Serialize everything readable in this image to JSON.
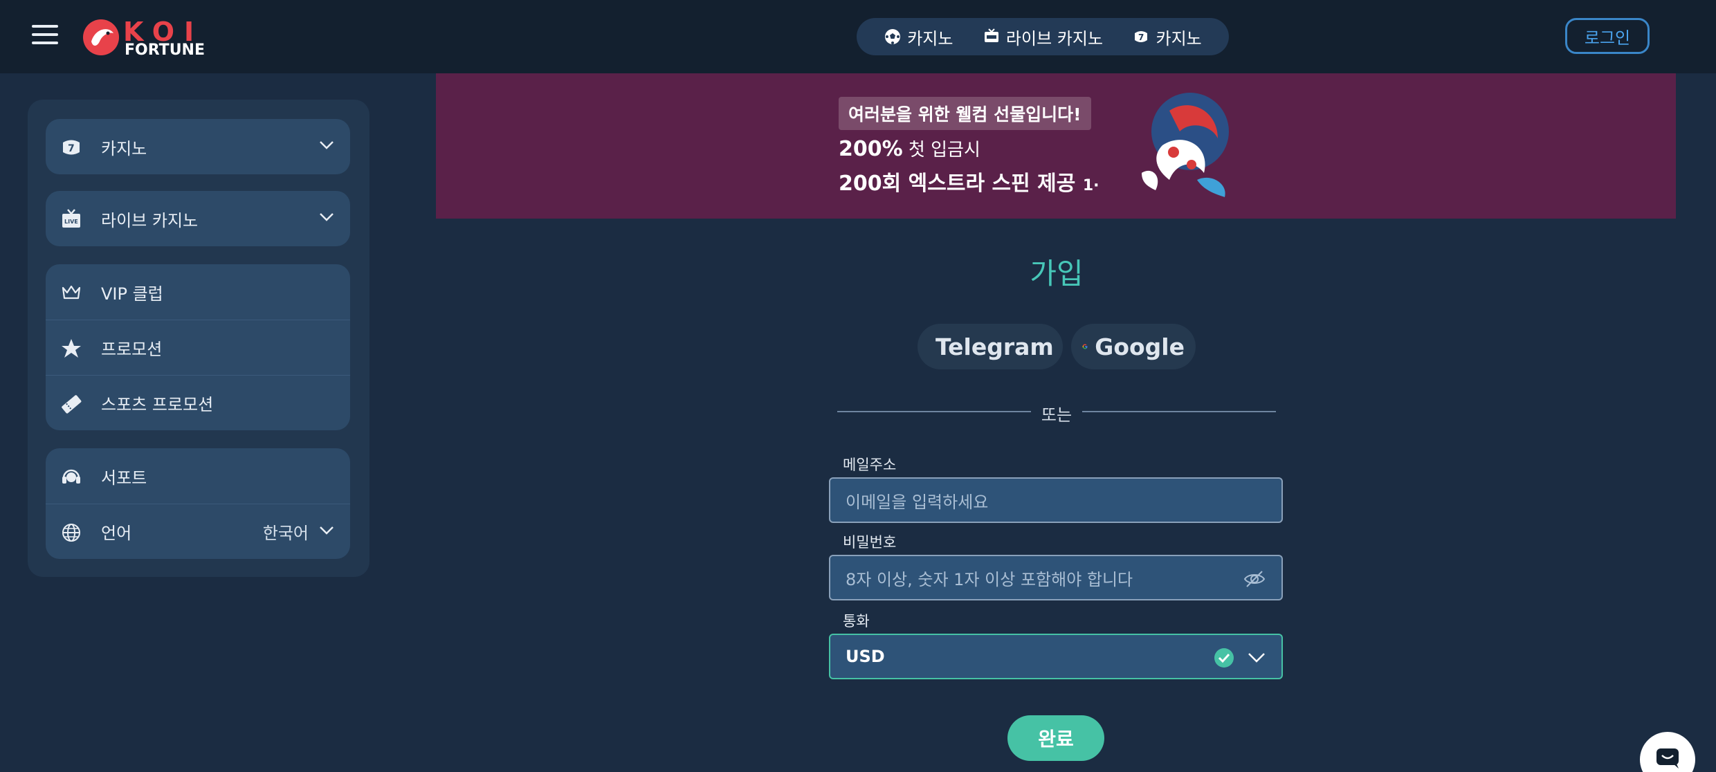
{
  "header": {
    "logo_top": "KOI",
    "logo_bottom": "FORTUNE",
    "nav": [
      {
        "label": "카지노",
        "icon": "soccer-ball-icon"
      },
      {
        "label": "라이브 카지노",
        "icon": "live-tv-icon"
      },
      {
        "label": "카지노",
        "icon": "slot-seven-icon"
      }
    ],
    "login_label": "로그인"
  },
  "sidebar": {
    "groups": [
      {
        "items": [
          {
            "label": "카지노",
            "icon": "slot-seven-icon"
          }
        ]
      },
      {
        "items": [
          {
            "label": "라이브 카지노",
            "icon": "live-tv-icon"
          }
        ]
      },
      {
        "items": [
          {
            "label": "VIP 클럽",
            "icon": "crown-icon"
          },
          {
            "label": "프로모션",
            "icon": "star-burst-icon"
          },
          {
            "label": "스포츠 프로모션",
            "icon": "ticket-icon"
          }
        ]
      },
      {
        "items": [
          {
            "label": "서포트",
            "icon": "headset-icon"
          },
          {
            "label": "언어",
            "icon": "globe-icon",
            "value": "한국어"
          }
        ]
      }
    ]
  },
  "banner": {
    "badge": "여러분을 위한 웰컴 선물입니다!",
    "line1_strong": "200%",
    "line1_rest": "첫 입금시",
    "line2": "200회 엑스트라 스핀 제공",
    "line2_suffix": "1·"
  },
  "form": {
    "title": "가입",
    "social": [
      {
        "label": "Telegram",
        "icon": "telegram-icon"
      },
      {
        "label": "Google",
        "icon": "google-icon"
      }
    ],
    "divider": "또는",
    "email_label": "메일주소",
    "email_placeholder": "이메일을 입력하세요",
    "password_label": "비밀번호",
    "password_placeholder": "8자 이상, 숫자 1자 이상 포함해야 합니다",
    "currency_label": "통화",
    "currency_value": "USD",
    "submit_label": "완료"
  },
  "colors": {
    "accent": "#46c2a5",
    "banner_bg": "#5a2149",
    "login_border": "#3a86c8"
  }
}
